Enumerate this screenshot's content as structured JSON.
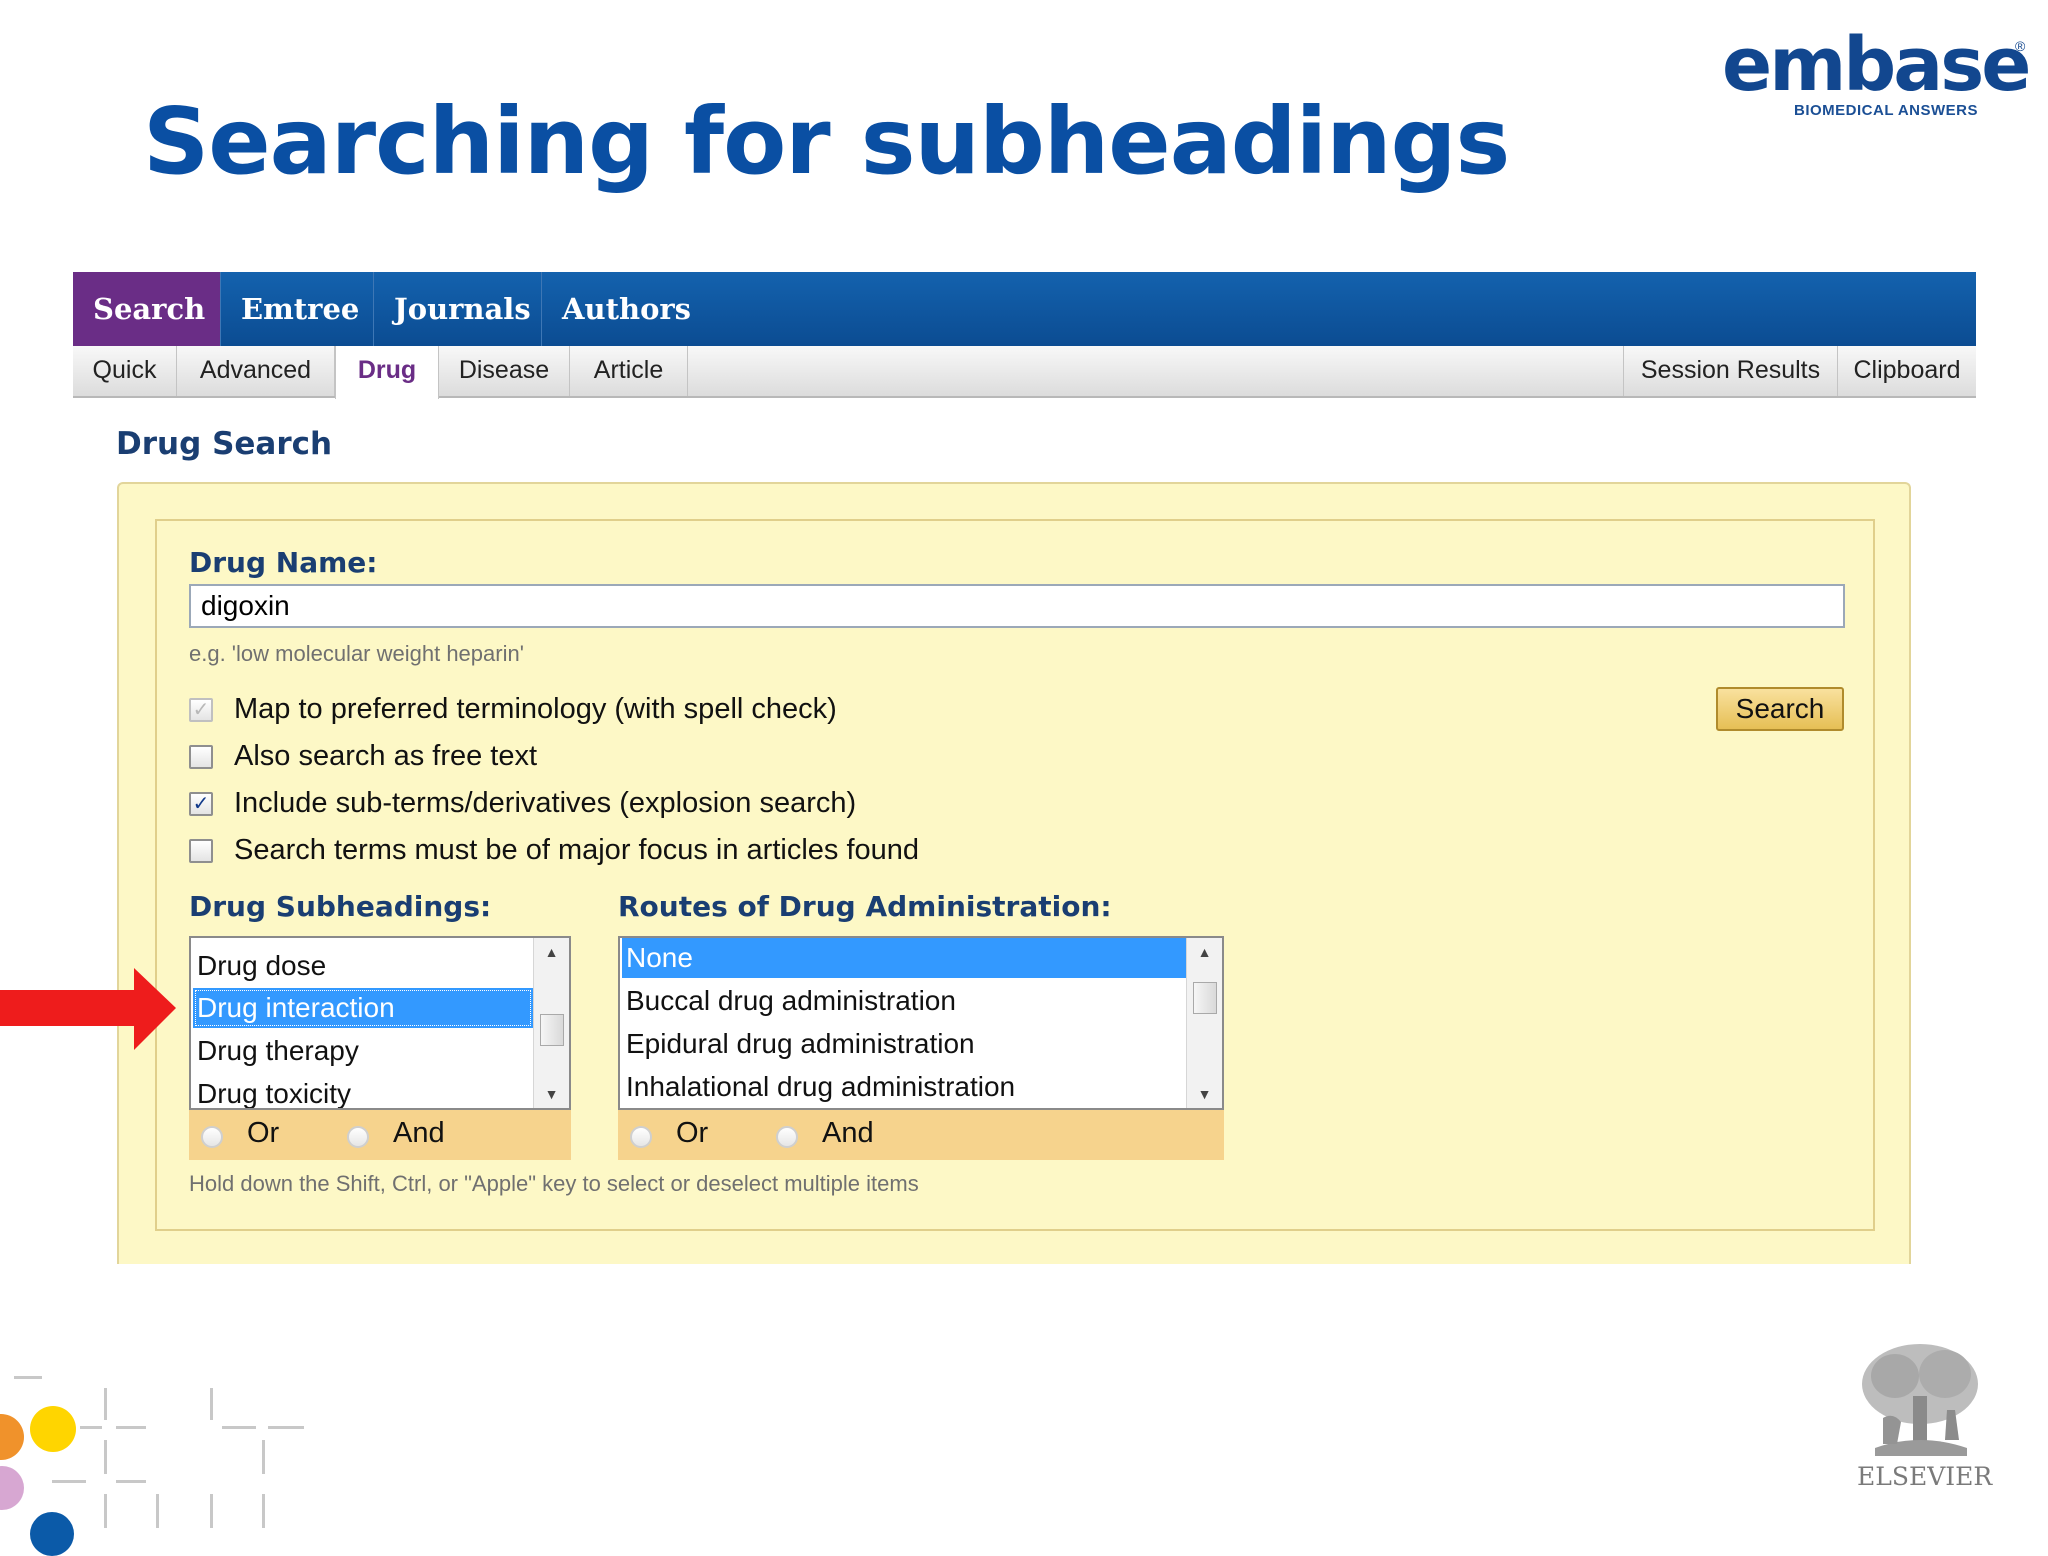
{
  "slide": {
    "title": "Searching for subheadings"
  },
  "logo": {
    "name": "embase",
    "registered": "®",
    "tagline": "BIOMEDICAL ANSWERS",
    "publisher": "ELSEVIER"
  },
  "topnav": {
    "tabs": [
      {
        "label": "Search",
        "active": true
      },
      {
        "label": "Emtree",
        "active": false
      },
      {
        "label": "Journals",
        "active": false
      },
      {
        "label": "Authors",
        "active": false
      }
    ]
  },
  "subnav": {
    "left_tabs": [
      {
        "label": "Quick",
        "active": false
      },
      {
        "label": "Advanced",
        "active": false
      },
      {
        "label": "Drug",
        "active": true
      },
      {
        "label": "Disease",
        "active": false
      },
      {
        "label": "Article",
        "active": false
      }
    ],
    "right_tabs": [
      {
        "label": "Session Results"
      },
      {
        "label": "Clipboard"
      }
    ]
  },
  "page": {
    "heading": "Drug Search"
  },
  "form": {
    "drug_name_label": "Drug Name:",
    "drug_name_value": "digoxin",
    "drug_name_hint": "e.g. 'low molecular weight heparin'",
    "search_button": "Search",
    "options": [
      {
        "label": "Map to preferred terminology (with spell check)",
        "checked": true,
        "disabled": true
      },
      {
        "label": "Also search as free text",
        "checked": false,
        "disabled": false
      },
      {
        "label": "Include sub-terms/derivatives (explosion search)",
        "checked": true,
        "disabled": false
      },
      {
        "label": "Search terms must be of major focus in articles found",
        "checked": false,
        "disabled": false
      }
    ],
    "subheadings": {
      "label": "Drug Subheadings:",
      "items": [
        {
          "label": "Drug dose",
          "selected": false
        },
        {
          "label": "Drug interaction",
          "selected": true
        },
        {
          "label": "Drug therapy",
          "selected": false
        },
        {
          "label": "Drug toxicity",
          "selected": false
        }
      ],
      "or_label": "Or",
      "and_label": "And"
    },
    "routes": {
      "label": "Routes of Drug Administration:",
      "items": [
        {
          "label": "None",
          "selected": true
        },
        {
          "label": "Buccal drug administration",
          "selected": false
        },
        {
          "label": "Epidural drug administration",
          "selected": false
        },
        {
          "label": "Inhalational drug administration",
          "selected": false
        }
      ],
      "or_label": "Or",
      "and_label": "And"
    },
    "multi_select_hint": "Hold down the Shift, Ctrl, or \"Apple\" key to select or deselect multiple items"
  },
  "colors": {
    "title_blue": "#0a4fa3",
    "nav_blue": "#0b4c92",
    "active_tab_purple": "#6a2d86",
    "panel_yellow": "#fdf8c6",
    "bool_bar": "#f6d38d",
    "selection_blue": "#3399ff",
    "arrow_red": "#ee1c1c"
  }
}
